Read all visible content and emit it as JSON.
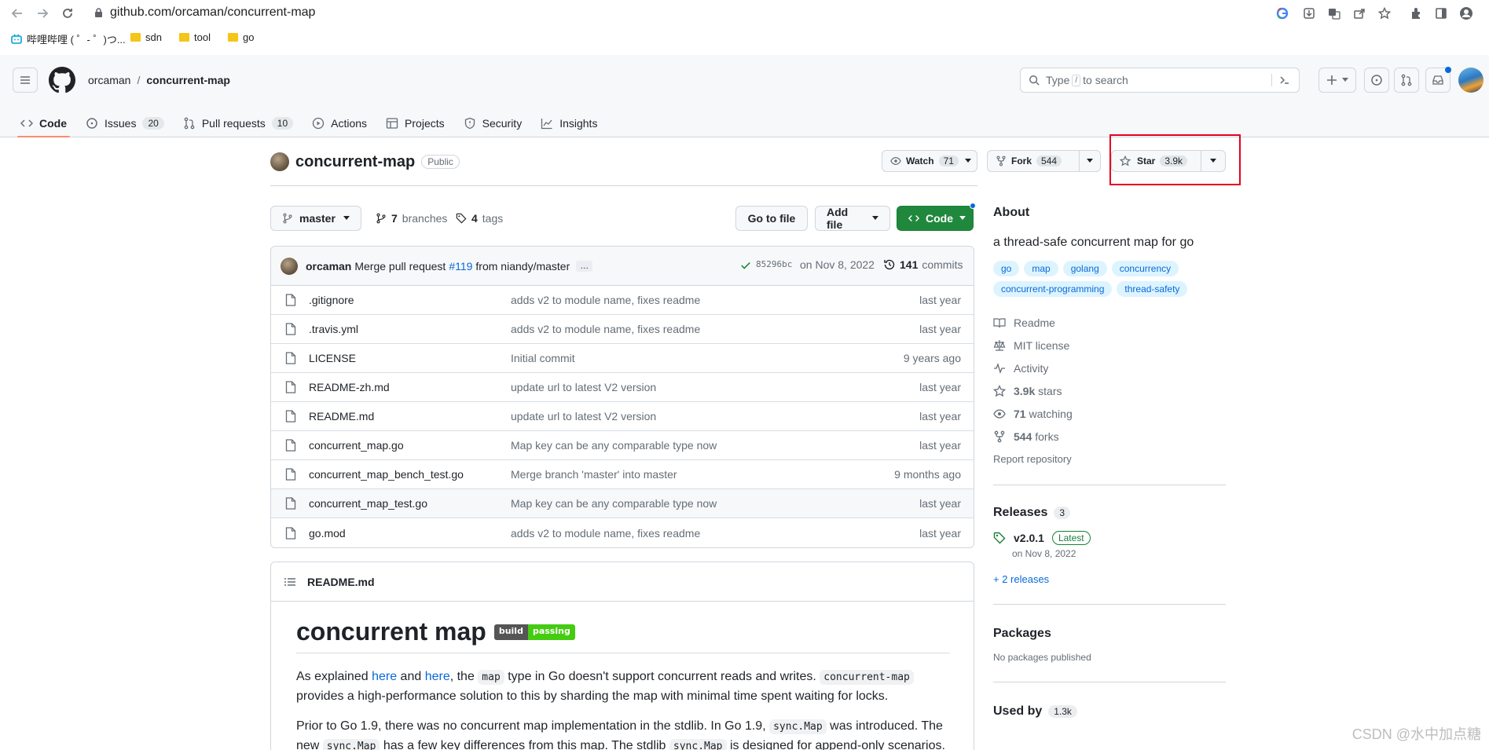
{
  "browser": {
    "url": "github.com/orcaman/concurrent-map",
    "bookmarks": [
      {
        "label": "哔哩哔哩 ( ゜- ゜)つ..."
      },
      {
        "label": "sdn"
      },
      {
        "label": "tool"
      },
      {
        "label": "go"
      }
    ]
  },
  "header": {
    "owner": "orcaman",
    "separator": "/",
    "repo": "concurrent-map",
    "search_prefix": "Type",
    "search_key": "/",
    "search_suffix": "to search"
  },
  "repo_nav": {
    "tabs": [
      {
        "label": "Code",
        "selected": true
      },
      {
        "label": "Issues",
        "count": "20"
      },
      {
        "label": "Pull requests",
        "count": "10"
      },
      {
        "label": "Actions"
      },
      {
        "label": "Projects"
      },
      {
        "label": "Security"
      },
      {
        "label": "Insights"
      }
    ]
  },
  "repo": {
    "name": "concurrent-map",
    "visibility": "Public",
    "watch_label": "Watch",
    "watch_count": "71",
    "fork_label": "Fork",
    "fork_count": "544",
    "star_label": "Star",
    "star_count": "3.9k"
  },
  "branch_bar": {
    "branch": "master",
    "branches_count": "7",
    "branches_label": "branches",
    "tags_count": "4",
    "tags_label": "tags",
    "go_to_file": "Go to file",
    "add_file": "Add file",
    "code": "Code"
  },
  "commit": {
    "author": "orcaman",
    "message_pre": "Merge pull request",
    "pr": "#119",
    "message_post": "from niandy/master",
    "ellipsis": "…",
    "sha": "85296bc",
    "date": "on Nov 8, 2022",
    "commits_count": "141",
    "commits_label": "commits"
  },
  "files": [
    {
      "name": ".gitignore",
      "message": "adds v2 to module name, fixes readme",
      "age": "last year"
    },
    {
      "name": ".travis.yml",
      "message": "adds v2 to module name, fixes readme",
      "age": "last year"
    },
    {
      "name": "LICENSE",
      "message": "Initial commit",
      "age": "9 years ago"
    },
    {
      "name": "README-zh.md",
      "message": "update url to latest V2 version",
      "age": "last year"
    },
    {
      "name": "README.md",
      "message": "update url to latest V2 version",
      "age": "last year"
    },
    {
      "name": "concurrent_map.go",
      "message": "Map key can be any comparable type now",
      "age": "last year"
    },
    {
      "name": "concurrent_map_bench_test.go",
      "message": "Merge branch 'master' into master",
      "age": "9 months ago"
    },
    {
      "name": "concurrent_map_test.go",
      "message": "Map key can be any comparable type now",
      "age": "last year"
    },
    {
      "name": "go.mod",
      "message": "adds v2 to module name, fixes readme",
      "age": "last year"
    }
  ],
  "readme": {
    "file": "README.md",
    "title": "concurrent map",
    "badge_left": "build",
    "badge_right": "passing",
    "p1_a": "As explained ",
    "p1_link1": "here",
    "p1_b": " and ",
    "p1_link2": "here",
    "p1_c": ", the ",
    "p1_code1": "map",
    "p1_d": " type in Go doesn't support concurrent reads and writes. ",
    "p1_code2": "concurrent-map",
    "p1_e": " provides a high-performance solution to this by sharding the map with minimal time spent waiting for locks.",
    "p2_a": "Prior to Go 1.9, there was no concurrent map implementation in the stdlib. In Go 1.9, ",
    "p2_code1": "sync.Map",
    "p2_b": " was introduced. The new ",
    "p2_code2": "sync.Map",
    "p2_c": " has a few key differences from this map. The stdlib ",
    "p2_code3": "sync.Map",
    "p2_d": " is designed for append-only scenarios."
  },
  "about": {
    "heading": "About",
    "description": "a thread-safe concurrent map for go",
    "topics": [
      "go",
      "map",
      "golang",
      "concurrency",
      "concurrent-programming",
      "thread-safety"
    ],
    "readme": "Readme",
    "license": "MIT license",
    "activity": "Activity",
    "stars_count": "3.9k",
    "stars_label": "stars",
    "watching_count": "71",
    "watching_label": "watching",
    "forks_count": "544",
    "forks_label": "forks",
    "report": "Report repository"
  },
  "releases": {
    "heading": "Releases",
    "count": "3",
    "tag": "v2.0.1",
    "latest": "Latest",
    "date": "on Nov 8, 2022",
    "more": "+ 2 releases"
  },
  "packages": {
    "heading": "Packages",
    "empty": "No packages published"
  },
  "used_by": {
    "heading": "Used by",
    "count": "1.3k"
  },
  "watermark": "CSDN @水中加点糖",
  "colors": {
    "accent": "#0969da",
    "primary_button": "#1f883d",
    "highlight": "#e5001f",
    "tab_underline": "#fd8c73"
  }
}
